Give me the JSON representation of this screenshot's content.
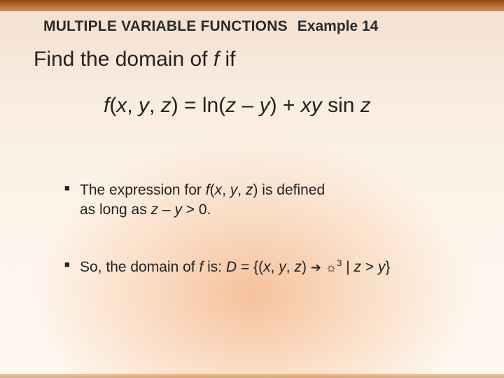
{
  "header": {
    "section_title": "MULTIPLE VARIABLE FUNCTIONS",
    "example_label": "Example 14"
  },
  "lead": {
    "prefix": "Find the domain of ",
    "f": "f",
    "suffix": " if"
  },
  "equation": {
    "f": "f",
    "args_open": "(",
    "x": "x",
    "c1": ", ",
    "y": "y",
    "c2": ", ",
    "z": "z",
    "args_close": ")",
    "eq": " = ln(",
    "z2": "z",
    "minus": " – ",
    "y2": "y",
    "close": ") + ",
    "xy": "xy",
    "sp": " sin ",
    "z3": "z"
  },
  "bullets": {
    "b1": {
      "t1": "The expression for ",
      "f": "f",
      "args": "(",
      "x": "x",
      "c1": ", ",
      "y": "y",
      "c2": ", ",
      "z": "z",
      "close": ")",
      "t2": " is defined as long as ",
      "z2": "z",
      "minus": " – ",
      "y2": "y",
      "gt": " > 0."
    },
    "b2": {
      "t1": "So, the domain of ",
      "f": "f",
      "t2": " is: ",
      "D": "D",
      "eq": " = {(",
      "x": "x",
      "c1": ", ",
      "y": "y",
      "c2": ", ",
      "z": "z",
      "close": ") ",
      "arrow": "➔",
      "sp1": " ",
      "sun": "☼",
      "exp": "3",
      "bar": " | ",
      "z2": "z",
      "gt": " > ",
      "y2": "y",
      "brace": "}"
    }
  }
}
